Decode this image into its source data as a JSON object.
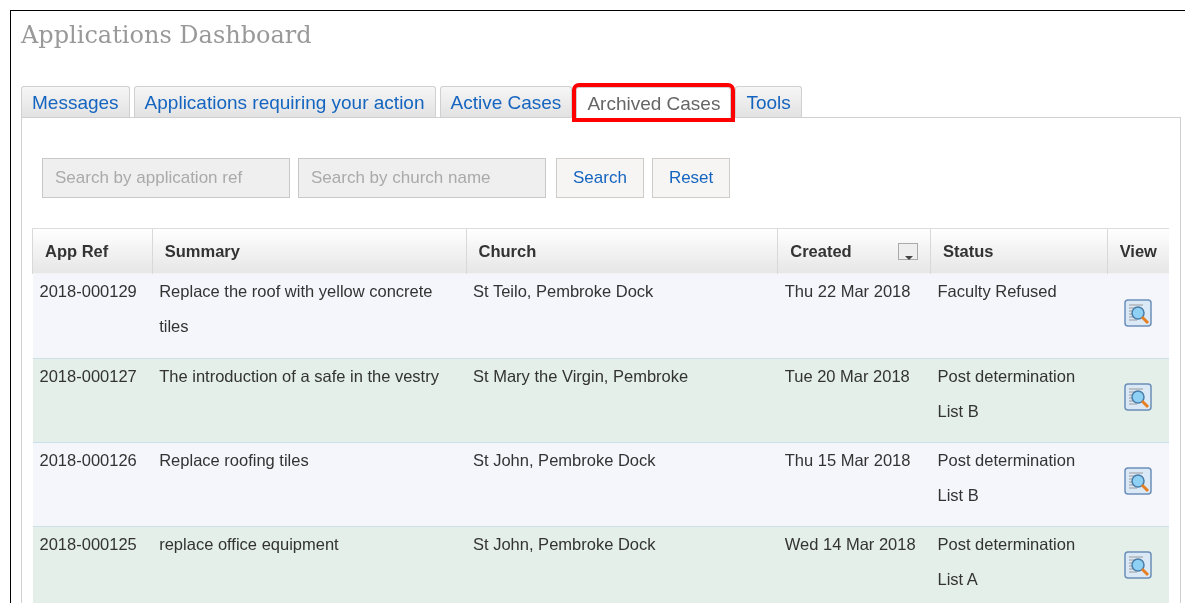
{
  "title": "Applications Dashboard",
  "tabs": [
    {
      "label": "Messages",
      "selected": false,
      "highlighted": false
    },
    {
      "label": "Applications requiring your action",
      "selected": false,
      "highlighted": false
    },
    {
      "label": "Active Cases",
      "selected": false,
      "highlighted": false
    },
    {
      "label": "Archived Cases",
      "selected": true,
      "highlighted": true
    },
    {
      "label": "Tools",
      "selected": false,
      "highlighted": false
    }
  ],
  "search": {
    "fields": [
      {
        "placeholder": "Search by application ref"
      },
      {
        "placeholder": "Search by church name"
      }
    ],
    "buttons": [
      "Search",
      "Reset"
    ]
  },
  "table": {
    "columns": [
      {
        "label": "App Ref",
        "sortable": false
      },
      {
        "label": "Summary",
        "sortable": false
      },
      {
        "label": "Church",
        "sortable": false
      },
      {
        "label": "Created",
        "sortable": true
      },
      {
        "label": "Status",
        "sortable": false
      },
      {
        "label": "View",
        "sortable": false
      }
    ],
    "rows": [
      {
        "ref": "2018-000129",
        "summary": "Replace the roof with yellow concrete tiles",
        "church": "St Teilo, Pembroke Dock",
        "created": "Thu 22 Mar 2018",
        "status": "Faculty Refused"
      },
      {
        "ref": "2018-000127",
        "summary": "The introduction of a safe in the vestry",
        "church": "St Mary the Virgin, Pembroke",
        "created": "Tue 20 Mar 2018",
        "status": "Post determination List B"
      },
      {
        "ref": "2018-000126",
        "summary": "Replace roofing tiles",
        "church": "St John, Pembroke Dock",
        "created": "Thu 15 Mar 2018",
        "status": "Post determination List B"
      },
      {
        "ref": "2018-000125",
        "summary": "replace office equipment",
        "church": "St John, Pembroke Dock",
        "created": "Wed 14 Mar 2018",
        "status": "Post determination List A"
      }
    ]
  }
}
